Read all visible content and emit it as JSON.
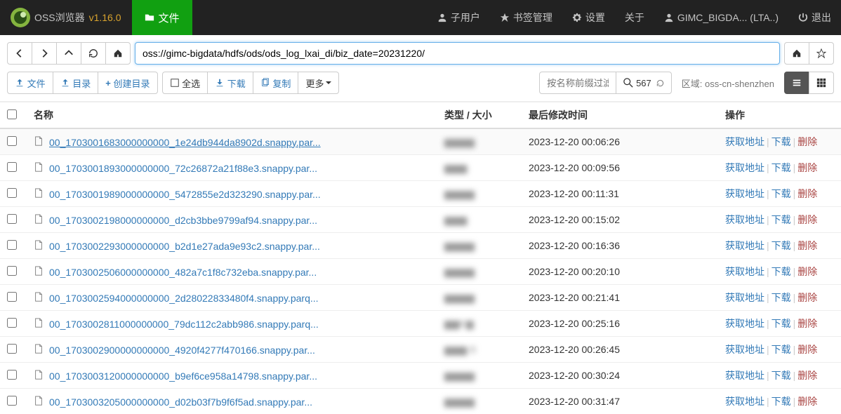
{
  "navbar": {
    "brand": "OSS浏览器",
    "version": "v1.16.0",
    "file_tab": "文件",
    "subuser": "子用户",
    "bookmark": "书签管理",
    "settings": "设置",
    "about": "关于",
    "user": "GIMC_BIGDA... (LTA..)",
    "logout": "退出"
  },
  "address": "oss://gimc-bigdata/hdfs/ods/ods_log_lxai_di/biz_date=20231220/",
  "toolbar": {
    "upload": "文件",
    "dir": "目录",
    "mkdir": "创建目录",
    "select_all": "全选",
    "download": "下载",
    "copy": "复制",
    "more": "更多",
    "filter_placeholder": "按名称前缀过滤",
    "count": "567",
    "region_label": "区域: oss-cn-shenzhen"
  },
  "headers": {
    "name": "名称",
    "type_size": "类型 / 大小",
    "modified": "最后修改时间",
    "ops": "操作"
  },
  "ops": {
    "addr": "获取地址",
    "dl": "下载",
    "del": "删除"
  },
  "files": [
    {
      "name": "00_1703001683000000000_1e24db944da8902d.snappy.par...",
      "size": "▆▆▆▆",
      "mod": "2023-12-20 00:06:26",
      "selected": true
    },
    {
      "name": "00_1703001893000000000_72c26872a21f88e3.snappy.par...",
      "size": "▆▆▆",
      "mod": "2023-12-20 00:09:56",
      "selected": false
    },
    {
      "name": "00_1703001989000000000_5472855e2d323290.snappy.par...",
      "size": "▆▆▆▆",
      "mod": "2023-12-20 00:11:31",
      "selected": false
    },
    {
      "name": "00_1703002198000000000_d2cb3bbe9799af94.snappy.par...",
      "size": "▆▆▆",
      "mod": "2023-12-20 00:15:02",
      "selected": false
    },
    {
      "name": "00_1703002293000000000_b2d1e27ada9e93c2.snappy.par...",
      "size": "▆▆▆▆",
      "mod": "2023-12-20 00:16:36",
      "selected": false
    },
    {
      "name": "00_1703002506000000000_482a7c1f8c732eba.snappy.par...",
      "size": "▆▆▆▆",
      "mod": "2023-12-20 00:20:10",
      "selected": false
    },
    {
      "name": "00_1703002594000000000_2d28022833480f4.snappy.parq...",
      "size": "▆▆▆▆",
      "mod": "2023-12-20 00:21:41",
      "selected": false
    },
    {
      "name": "00_1703002811000000000_79dc112c2abb986.snappy.parq...",
      "size": "▆▆K▆",
      "mod": "2023-12-20 00:25:16",
      "selected": false
    },
    {
      "name": "00_1703002900000000000_4920f4277f470166.snappy.par...",
      "size": "▆▆▆ B",
      "mod": "2023-12-20 00:26:45",
      "selected": false
    },
    {
      "name": "00_1703003120000000000_b9ef6ce958a14798.snappy.par...",
      "size": "▆▆▆▆",
      "mod": "2023-12-20 00:30:24",
      "selected": false
    },
    {
      "name": "00_1703003205000000000_d02b03f7b9f6f5ad.snappy.par...",
      "size": "▆▆▆▆",
      "mod": "2023-12-20 00:31:47",
      "selected": false
    }
  ]
}
